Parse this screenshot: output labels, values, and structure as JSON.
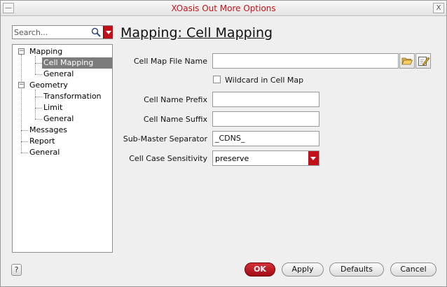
{
  "window": {
    "title": "XOasis Out More Options",
    "minimize_glyph": "—",
    "close_glyph": "X"
  },
  "search": {
    "placeholder": "Search..."
  },
  "tree": {
    "items": [
      {
        "label": "Mapping",
        "expanded": true
      },
      {
        "label": "Cell Mapping",
        "selected": true
      },
      {
        "label": "General"
      },
      {
        "label": "Geometry",
        "expanded": true
      },
      {
        "label": "Transformation"
      },
      {
        "label": "Limit"
      },
      {
        "label": "General"
      },
      {
        "label": "Messages"
      },
      {
        "label": "Report"
      },
      {
        "label": "General"
      }
    ],
    "expander_glyph": "−"
  },
  "main": {
    "title": "Mapping: Cell Mapping",
    "cell_map_file": {
      "label": "Cell Map File Name",
      "value": ""
    },
    "wildcard": {
      "label": "Wildcard in Cell Map",
      "checked": false
    },
    "cell_name_prefix": {
      "label": "Cell Name Prefix",
      "value": ""
    },
    "cell_name_suffix": {
      "label": "Cell Name Suffix",
      "value": ""
    },
    "sub_master_separator": {
      "label": "Sub-Master Separator",
      "value": "_CDNS_"
    },
    "cell_case_sensitivity": {
      "label": "Cell Case Sensitivity",
      "value": "preserve"
    }
  },
  "buttons": {
    "help": "?",
    "ok": "OK",
    "apply": "Apply",
    "defaults": "Defaults",
    "cancel": "Cancel"
  },
  "colors": {
    "accent_red": "#c0101a",
    "title_red": "#c2141a",
    "selection_gray": "#7c7c7c"
  }
}
